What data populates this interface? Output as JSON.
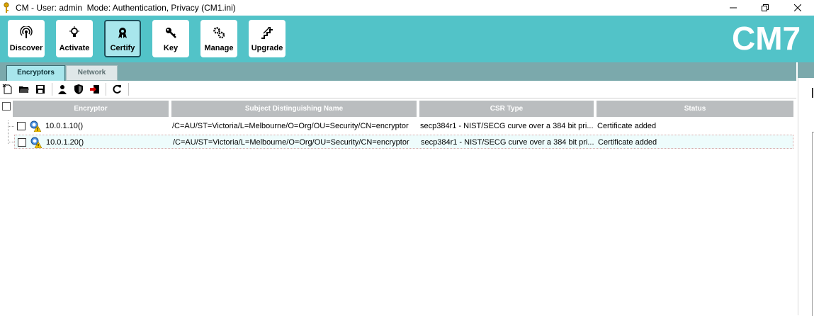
{
  "window": {
    "title": "CM - User: admin  Mode: Authentication, Privacy (CM1.ini)"
  },
  "ribbon": {
    "buttons": [
      {
        "label": "Discover",
        "icon": "discover-icon"
      },
      {
        "label": "Activate",
        "icon": "lightbulb-icon"
      },
      {
        "label": "Certify",
        "icon": "certificate-icon",
        "active": true
      },
      {
        "label": "Key",
        "icon": "key-icon"
      },
      {
        "label": "Manage",
        "icon": "gears-icon"
      },
      {
        "label": "Upgrade",
        "icon": "upgrade-stairs-icon"
      }
    ],
    "logo": "CM7"
  },
  "tabs": [
    {
      "label": "Encryptors",
      "active": true
    },
    {
      "label": "Network",
      "active": false
    }
  ],
  "toolbar": {
    "icons": [
      "new-file-icon",
      "open-folder-icon",
      "save-icon",
      "user-icon",
      "shield-icon",
      "export-icon",
      "refresh-icon"
    ]
  },
  "grid": {
    "columns": [
      "Encryptor",
      "Subject Distinguishing Name",
      "CSR Type",
      "Status"
    ],
    "rows": [
      {
        "encryptor": "10.0.1.10()",
        "subject": "/C=AU/ST=Victoria/L=Melbourne/O=Org/OU=Security/CN=encryptor",
        "csr_type": "secp384r1 - NIST/SECG curve over a 384 bit pri...",
        "status": "Certificate added"
      },
      {
        "encryptor": "10.0.1.20()",
        "subject": "/C=AU/ST=Victoria/L=Melbourne/O=Org/OU=Security/CN=encryptor",
        "csr_type": "secp384r1 - NIST/SECG curve over a 384 bit pri...",
        "status": "Certificate added"
      }
    ]
  },
  "colors": {
    "ribbon": "#52c3c8",
    "tab_strip": "#7ba9ac",
    "active_tab": "#a8e6ec",
    "header_cell": "#babdbf"
  }
}
